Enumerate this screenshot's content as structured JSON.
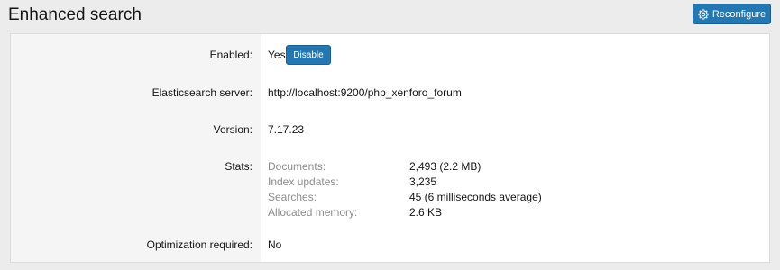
{
  "header": {
    "title": "Enhanced search",
    "reconfigure_label": "Reconfigure"
  },
  "rows": {
    "enabled": {
      "label": "Enabled:",
      "value": "Yes",
      "action_label": "Disable"
    },
    "server": {
      "label": "Elasticsearch server:",
      "value": "http://localhost:9200/php_xenforo_forum"
    },
    "version": {
      "label": "Version:",
      "value": "7.17.23"
    },
    "stats": {
      "label": "Stats:",
      "items": [
        {
          "name": "Documents:",
          "value": "2,493 (2.2 MB)"
        },
        {
          "name": "Index updates:",
          "value": "3,235"
        },
        {
          "name": "Searches:",
          "value": "45 (6 milliseconds average)"
        },
        {
          "name": "Allocated memory:",
          "value": "2.6 KB"
        }
      ]
    },
    "optimization": {
      "label": "Optimization required:",
      "value": "No"
    }
  },
  "colors": {
    "button": "#2577b1",
    "label_background": "#f5f5f5",
    "page_background": "#ececec",
    "muted_text": "#8c8c8c"
  },
  "icons": {
    "reconfigure": "gear-icon"
  }
}
